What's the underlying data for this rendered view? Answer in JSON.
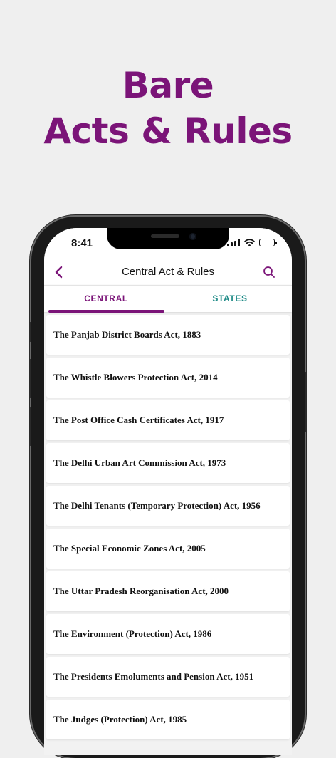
{
  "promo": {
    "line1": "Bare",
    "line2": "Acts & Rules"
  },
  "status": {
    "time": "8:41"
  },
  "header": {
    "title": "Central Act & Rules"
  },
  "tabs": [
    {
      "label": "CENTRAL",
      "selected": true
    },
    {
      "label": "STATES",
      "selected": false
    }
  ],
  "acts": [
    "The Panjab District Boards Act, 1883",
    "The Whistle Blowers Protection Act, 2014",
    "The Post Office Cash Certificates Act, 1917",
    "The Delhi Urban Art Commission Act, 1973",
    "The Delhi Tenants (Temporary Protection) Act, 1956",
    "The Special Economic Zones Act, 2005",
    "The Uttar Pradesh Reorganisation Act, 2000",
    "The Environment (Protection) Act, 1986",
    "The Presidents Emoluments and Pension Act, 1951",
    "The Judges (Protection) Act, 1985"
  ],
  "colors": {
    "brand": "#7b1478",
    "states_tab": "#1d8a86",
    "background": "#efefef"
  },
  "icons": {
    "back": "chevron-left-icon",
    "search": "search-icon"
  }
}
